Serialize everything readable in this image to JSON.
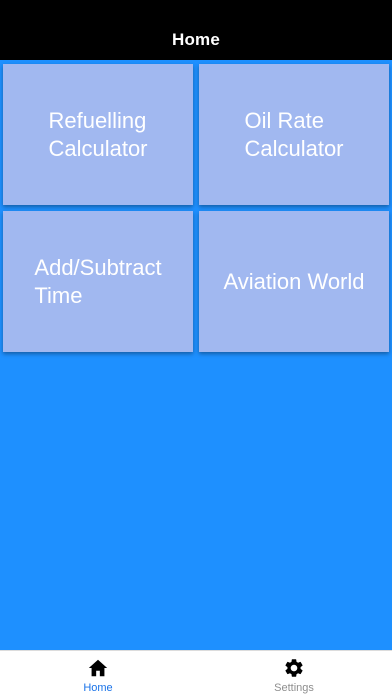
{
  "header": {
    "title": "Home"
  },
  "tiles": [
    {
      "label": "Refuelling\nCalculator"
    },
    {
      "label": "Oil Rate\nCalculator"
    },
    {
      "label": "Add/Subtract\nTime"
    },
    {
      "label": "Aviation World"
    }
  ],
  "tab_bar": {
    "tabs": [
      {
        "label": "Home",
        "icon": "home-icon",
        "active": true
      },
      {
        "label": "Settings",
        "icon": "gear-icon",
        "active": false
      }
    ]
  },
  "colors": {
    "background": "#1e90ff",
    "tile": "#a1b8f0",
    "header": "#000000",
    "active_tab": "#1a73e8",
    "inactive_tab": "#8e8e8e"
  }
}
